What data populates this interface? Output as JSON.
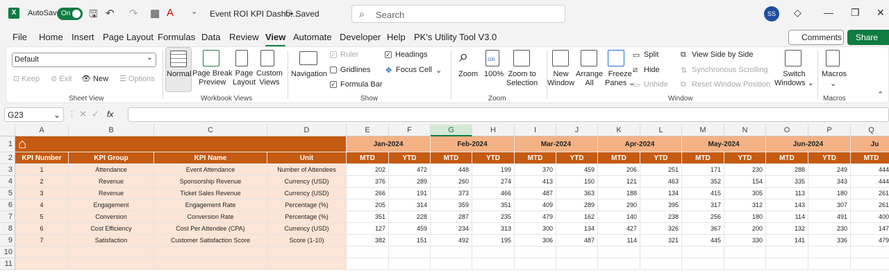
{
  "titlebar": {
    "app_badge": "X",
    "autosave_label": "AutoSave",
    "autosave_state": "On",
    "doc_title": "Event ROI KPI Dashb...",
    "saved_status": "• Saved",
    "search_placeholder": "Search",
    "avatar_initials": "SS"
  },
  "tabs": [
    "File",
    "Home",
    "Insert",
    "Page Layout",
    "Formulas",
    "Data",
    "Review",
    "View",
    "Automate",
    "Developer",
    "Help",
    "PK's Utility Tool V3.0"
  ],
  "active_tab": "View",
  "actions": {
    "comments": "Comments",
    "share": "Share"
  },
  "ribbon": {
    "sheet_view": {
      "select_value": "Default",
      "keep": "Keep",
      "exit": "Exit",
      "new": "New",
      "options": "Options",
      "label": "Sheet View"
    },
    "workbook_views": {
      "normal": "Normal",
      "page_break_1": "Page Break",
      "page_break_2": "Preview",
      "page_layout_1": "Page",
      "page_layout_2": "Layout",
      "custom_views_1": "Custom",
      "custom_views_2": "Views",
      "label": "Workbook Views"
    },
    "show": {
      "navigation": "Navigation",
      "ruler": "Ruler",
      "gridlines": "Gridlines",
      "formula_bar": "Formula Bar",
      "headings": "Headings",
      "focus_cell": "Focus Cell",
      "label": "Show"
    },
    "zoom": {
      "zoom": "Zoom",
      "hundred": "100%",
      "hundred_icon": "100",
      "zoom_sel_1": "Zoom to",
      "zoom_sel_2": "Selection",
      "label": "Zoom"
    },
    "window": {
      "new_window_1": "New",
      "new_window_2": "Window",
      "arrange_1": "Arrange",
      "arrange_2": "All",
      "freeze_1": "Freeze",
      "freeze_2": "Panes",
      "split": "Split",
      "hide": "Hide",
      "unhide": "Unhide",
      "side_by_side": "View Side by Side",
      "sync_scroll": "Synchronous Scrolling",
      "reset_pos": "Reset Window Position",
      "switch_1": "Switch",
      "switch_2": "Windows",
      "label": "Window"
    },
    "macros": {
      "macros": "Macros",
      "label": "Macros"
    }
  },
  "formula_bar": {
    "name_box": "G23",
    "fx": "fx",
    "content": ""
  },
  "sheet": {
    "columns": [
      "A",
      "B",
      "C",
      "D",
      "E",
      "F",
      "G",
      "H",
      "I",
      "J",
      "K",
      "L",
      "M",
      "N",
      "O",
      "P",
      "Q"
    ],
    "rows": [
      "1",
      "2",
      "3",
      "4",
      "5",
      "6",
      "7",
      "8",
      "9",
      "10",
      "11"
    ],
    "headers": [
      "KPI Number",
      "KPI Group",
      "KPI Name",
      "Unit"
    ],
    "months": [
      "Jan-2024",
      "Feb-2024",
      "Mar-2024",
      "Apr-2024",
      "May-2024",
      "Jun-2024",
      "Ju"
    ],
    "sub": [
      "MTD",
      "YTD"
    ],
    "kpis": [
      {
        "num": "1",
        "group": "Attendance",
        "name": "Event Attendance",
        "unit": "Number of Attendees",
        "vals": [
          "202",
          "472",
          "448",
          "199",
          "370",
          "459",
          "206",
          "251",
          "171",
          "230",
          "288",
          "249",
          "444"
        ]
      },
      {
        "num": "2",
        "group": "Revenue",
        "name": "Sponsorship Revenue",
        "unit": "Currency (USD)",
        "vals": [
          "376",
          "289",
          "260",
          "274",
          "413",
          "150",
          "121",
          "463",
          "352",
          "154",
          "335",
          "343",
          "444"
        ]
      },
      {
        "num": "3",
        "group": "Revenue",
        "name": "Ticket Sales Revenue",
        "unit": "Currency (USD)",
        "vals": [
          "266",
          "191",
          "373",
          "466",
          "487",
          "363",
          "188",
          "134",
          "415",
          "305",
          "113",
          "180",
          "261"
        ]
      },
      {
        "num": "4",
        "group": "Engagement",
        "name": "Engagement Rate",
        "unit": "Percentage (%)",
        "vals": [
          "205",
          "314",
          "359",
          "351",
          "409",
          "289",
          "290",
          "395",
          "317",
          "312",
          "143",
          "307",
          "261"
        ]
      },
      {
        "num": "5",
        "group": "Conversion",
        "name": "Conversion Rate",
        "unit": "Percentage (%)",
        "vals": [
          "351",
          "228",
          "287",
          "235",
          "479",
          "162",
          "140",
          "238",
          "256",
          "180",
          "114",
          "491",
          "400"
        ]
      },
      {
        "num": "6",
        "group": "Cost Efficiency",
        "name": "Cost Per Attendee (CPA)",
        "unit": "Currency (USD)",
        "vals": [
          "127",
          "459",
          "234",
          "313",
          "300",
          "134",
          "427",
          "326",
          "367",
          "200",
          "132",
          "230",
          "147"
        ]
      },
      {
        "num": "7",
        "group": "Satisfaction",
        "name": "Customer Satisfaction Score",
        "unit": "Score (1-10)",
        "vals": [
          "382",
          "151",
          "492",
          "195",
          "306",
          "487",
          "114",
          "321",
          "445",
          "330",
          "141",
          "336",
          "479"
        ]
      }
    ]
  }
}
